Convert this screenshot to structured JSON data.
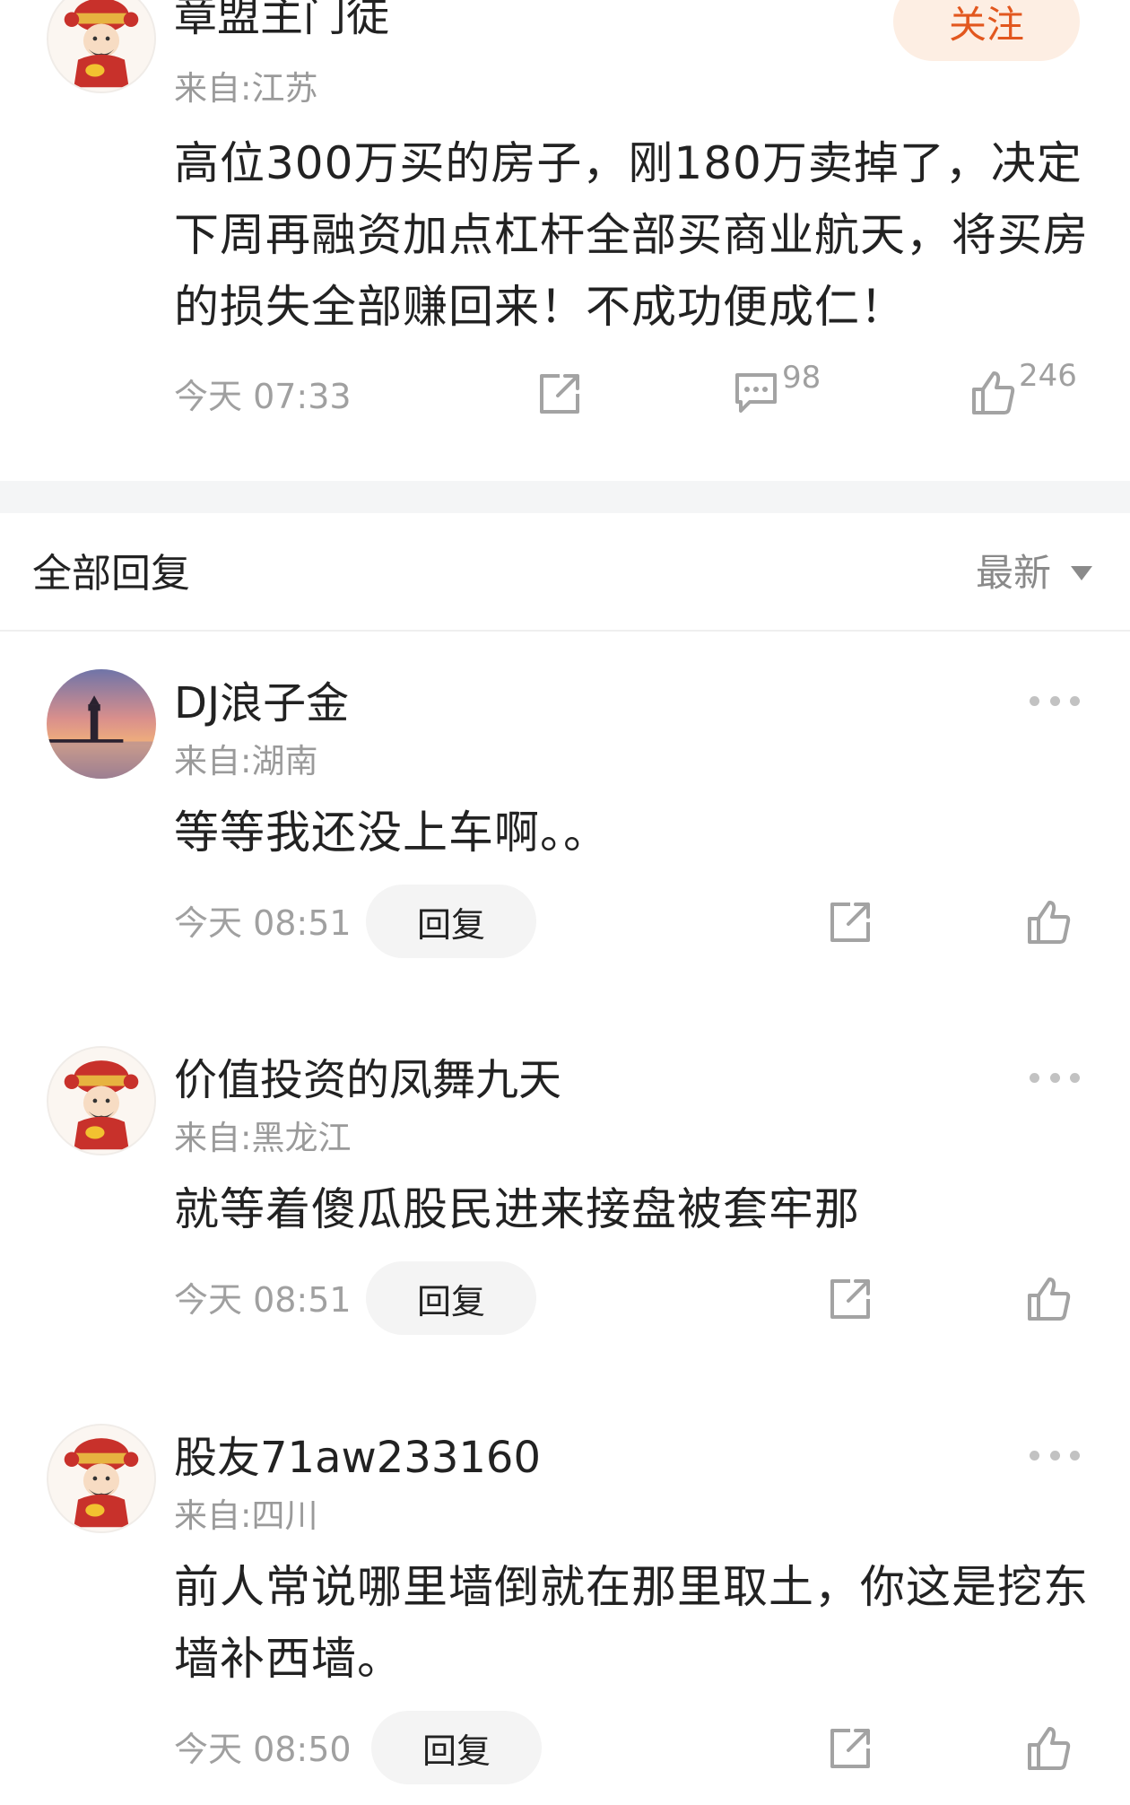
{
  "main_post": {
    "username": "章盟主门徒",
    "location": "来自:江苏",
    "follow_label": "关注",
    "content": "高位300万买的房子，刚180万卖掉了，决定下周再融资加点杠杆全部买商业航天，将买房的损失全部赚回来！不成功便成仁！",
    "time": "今天 07:33",
    "comment_count": "98",
    "like_count": "246"
  },
  "replies_header": {
    "title": "全部回复",
    "sort_label": "最新"
  },
  "comments": [
    {
      "username": "DJ浪子金",
      "location": "来自:湖南",
      "content": "等等我还没上车啊。。",
      "time": "今天 08:51",
      "reply_label": "回复",
      "avatar": "lighthouse-sunset-avatar"
    },
    {
      "username": "价值投资的凤舞九天",
      "location": "来自:黑龙江",
      "content": "就等着傻瓜股民进来接盘被套牢那",
      "time": "今天 08:51",
      "reply_label": "回复",
      "avatar": "god-of-wealth-avatar"
    },
    {
      "username": "股友71aw233160",
      "location": "来自:四川",
      "content": "前人常说哪里墙倒就在那里取土，你这是挖东墙补西墙。",
      "time": "今天 08:50",
      "reply_label": "回复",
      "avatar": "god-of-wealth-avatar"
    }
  ],
  "colors": {
    "accent": "#e2571e",
    "follow_bg": "#fdeee3",
    "text_primary": "#222222",
    "text_secondary": "#9a9a9a",
    "separator": "#f4f5f6"
  }
}
